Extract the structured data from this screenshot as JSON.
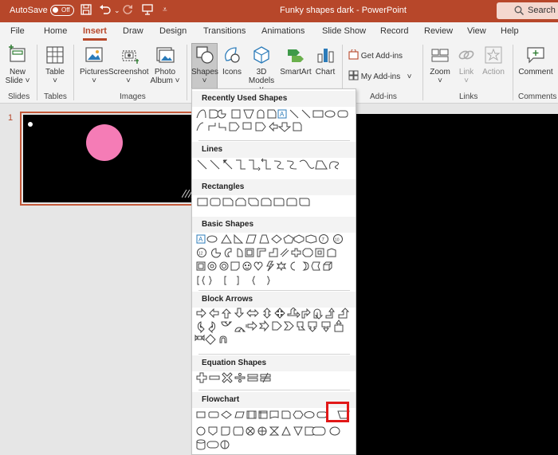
{
  "titlebar": {
    "autosave_label": "AutoSave",
    "toggle_state": "Off",
    "doc_title": "Funky shapes dark  -  PowerPoint",
    "search_placeholder": "Search (A"
  },
  "tabs": [
    {
      "label": "File"
    },
    {
      "label": "Home"
    },
    {
      "label": "Insert",
      "active": true
    },
    {
      "label": "Draw"
    },
    {
      "label": "Design"
    },
    {
      "label": "Transitions"
    },
    {
      "label": "Animations"
    },
    {
      "label": "Slide Show"
    },
    {
      "label": "Record"
    },
    {
      "label": "Review"
    },
    {
      "label": "View"
    },
    {
      "label": "Help"
    }
  ],
  "ribbon": {
    "new_slide": {
      "line1": "New",
      "line2": "Slide"
    },
    "table": "Table",
    "pictures": "Pictures",
    "screenshot": "Screenshot",
    "photo_album": {
      "line1": "Photo",
      "line2": "Album"
    },
    "shapes": "Shapes",
    "icons": "Icons",
    "models": {
      "line1": "3D",
      "line2": "Models"
    },
    "smartart": "SmartArt",
    "chart": "Chart",
    "get_addins": "Get Add-ins",
    "my_addins": "My Add-ins",
    "zoom": "Zoom",
    "link": "Link",
    "action": "Action",
    "comment": "Comment",
    "groups": {
      "slides": "Slides",
      "tables": "Tables",
      "images": "Images",
      "addins": "Add-ins",
      "links": "Links",
      "comments": "Comments"
    }
  },
  "slide_panel": {
    "slide_number": "1"
  },
  "colors": {
    "accent": "#b7472a",
    "circle": "#f57cb6",
    "highlight": "#e11818"
  },
  "gallery": {
    "categories": [
      {
        "id": "recent",
        "title": "Recently Used Shapes"
      },
      {
        "id": "lines",
        "title": "Lines"
      },
      {
        "id": "rectangles",
        "title": "Rectangles"
      },
      {
        "id": "basic",
        "title": "Basic Shapes"
      },
      {
        "id": "block_arrows",
        "title": "Block Arrows"
      },
      {
        "id": "equation",
        "title": "Equation Shapes"
      },
      {
        "id": "flowchart",
        "title": "Flowchart"
      }
    ],
    "highlighted_shape": "flowchart-manual-operation"
  }
}
